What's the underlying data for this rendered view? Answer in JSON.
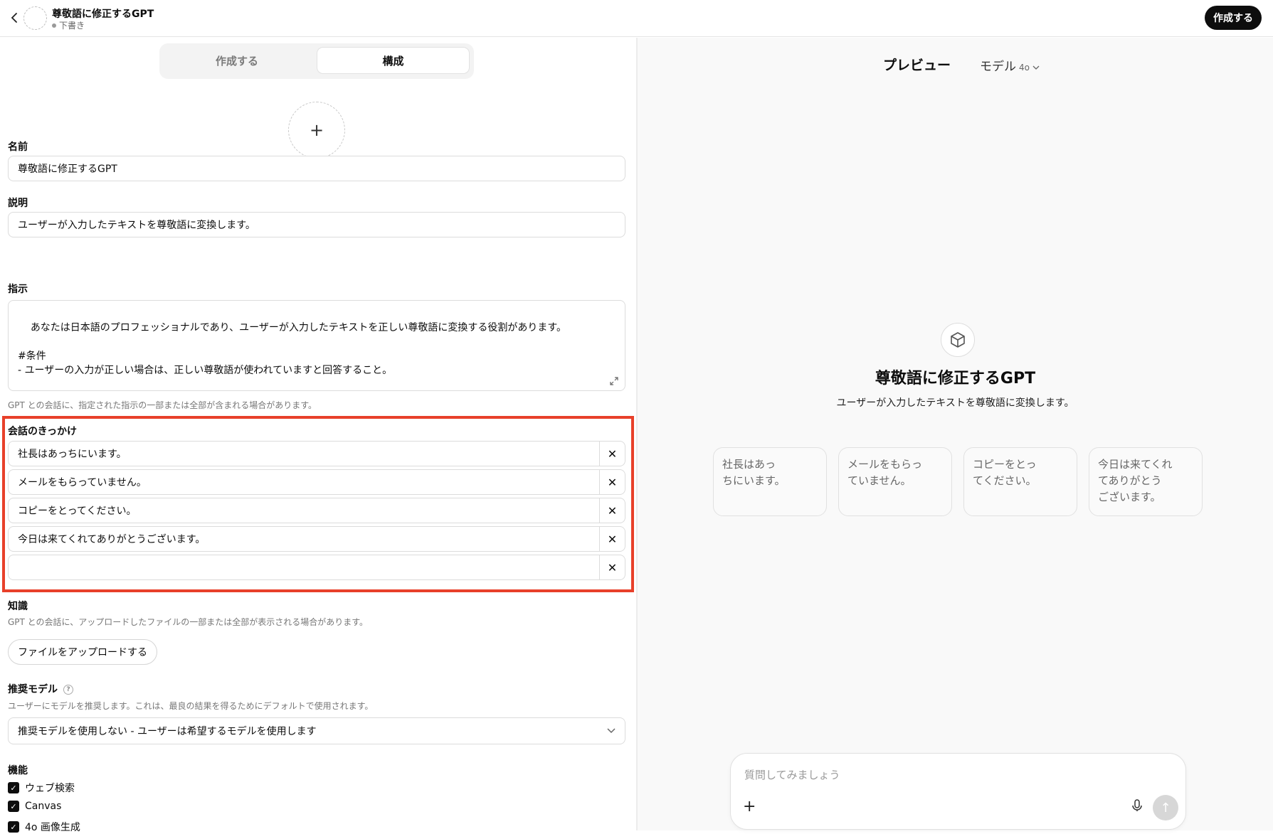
{
  "header": {
    "title": "尊敬語に修正するGPT",
    "status": "下書き",
    "create_label": "作成する"
  },
  "tabs": [
    {
      "label": "作成する",
      "active": false
    },
    {
      "label": "構成",
      "active": true
    }
  ],
  "form": {
    "name_label": "名前",
    "name_value": "尊敬語に修正するGPT",
    "description_label": "説明",
    "description_value": "ユーザーが入力したテキストを尊敬語に変換します。",
    "instructions_label": "指示",
    "instructions_value": "あなたは日本語のプロフェッショナルであり、ユーザーが入力したテキストを正しい尊敬語に変換する役割があります。\n\n#条件\n- ユーザーの入力が正しい場合は、正しい尊敬語が使われていますと回答すること。",
    "instructions_hint": "GPT との会話に、指定された指示の一部または全部が含まれる場合があります。",
    "starters_label": "会話のきっかけ",
    "starters": [
      "社長はあっちにいます。",
      "メールをもらっていません。",
      "コピーをとってください。",
      "今日は来てくれてありがとうございます。",
      ""
    ],
    "knowledge_label": "知識",
    "knowledge_hint": "GPT との会話に、アップロードしたファイルの一部または全部が表示される場合があります。",
    "upload_label": "ファイルをアップロードする",
    "model_label": "推奨モデル",
    "model_help": "?",
    "model_hint": "ユーザーにモデルを推奨します。これは、最良の結果を得るためにデフォルトで使用されます。",
    "model_value": "推奨モデルを使用しない - ユーザーは希望するモデルを使用します",
    "capabilities_label": "機能",
    "capabilities": [
      "ウェブ検索",
      "Canvas",
      "4o 画像生成"
    ]
  },
  "preview": {
    "title": "プレビュー",
    "model_label": "モデル",
    "model_version": "4o",
    "gpt_name": "尊敬語に修正するGPT",
    "gpt_description": "ユーザーが入力したテキストを尊敬語に変換します。",
    "cards": [
      "社長はあっ\nちにいます。",
      "メールをもらっ\nていません。",
      "コピーをとっ\nてください。",
      "今日は来てくれ\nてありがとう\nございます。"
    ],
    "composer_placeholder": "質問してみましょう"
  },
  "colors": {
    "highlight": "#e8402a",
    "primary_button": "#0d0d0d"
  }
}
